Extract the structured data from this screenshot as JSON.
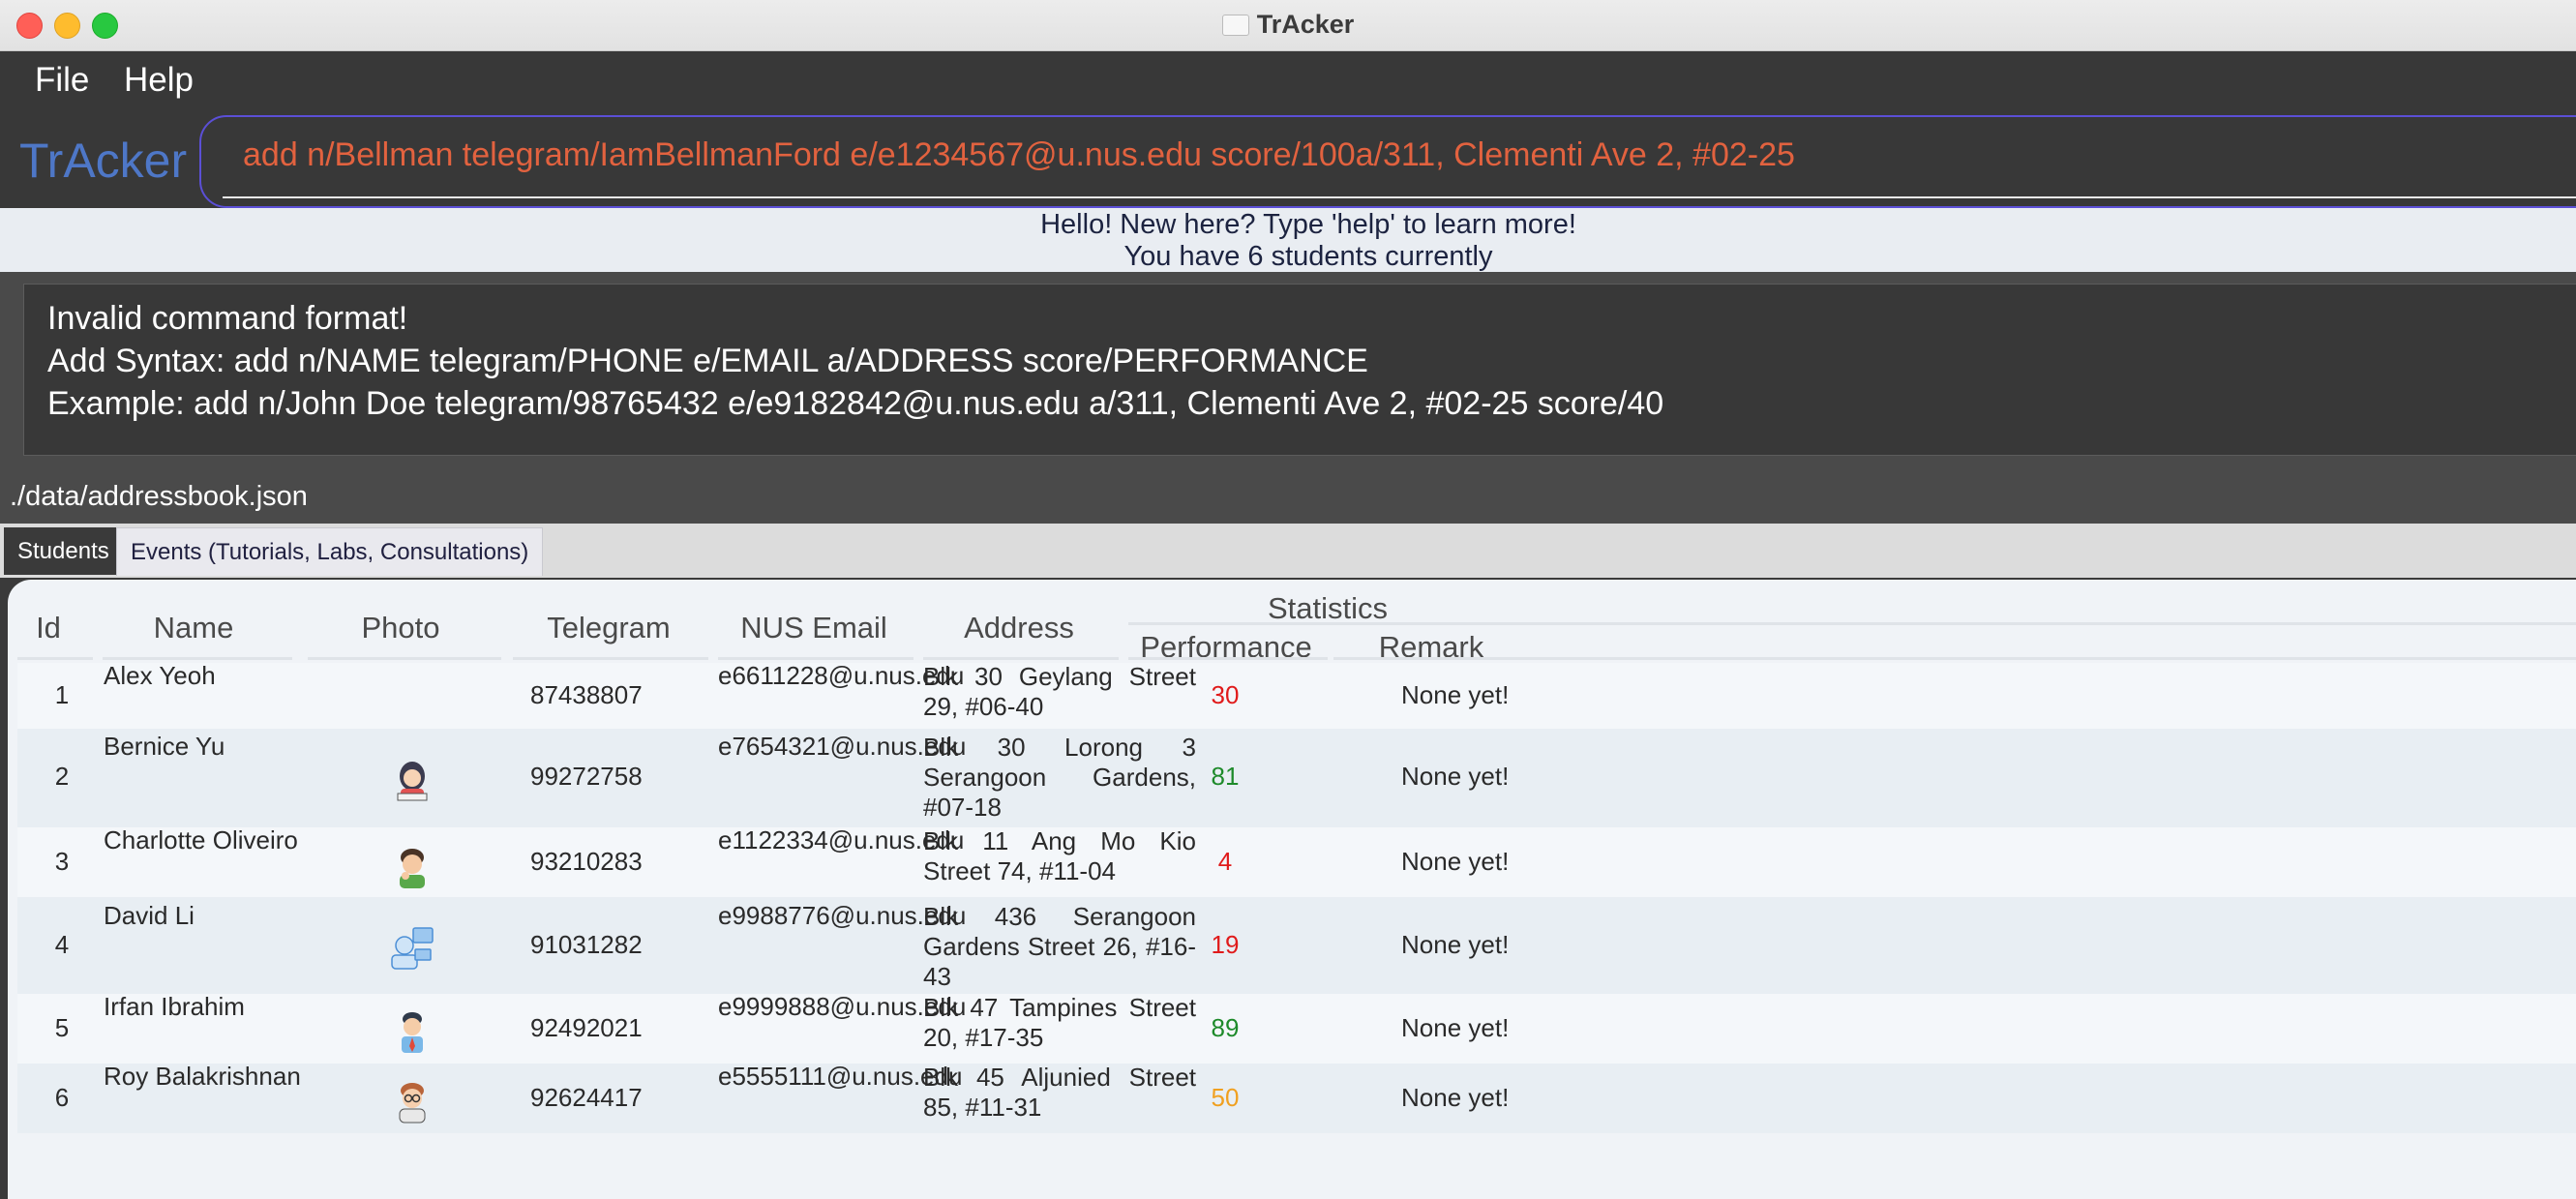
{
  "window": {
    "title": "TrAcker"
  },
  "menu": {
    "items": [
      "File",
      "Help"
    ]
  },
  "app": {
    "brand": "TrAcker"
  },
  "command": {
    "value": "add n/Bellman telegram/IamBellmanFord e/e1234567@u.nus.edu score/100a/311, Clementi Ave 2, #02-25"
  },
  "greeting": {
    "line1": "Hello! New here? Type 'help' to learn more!",
    "line2": "You have 6 students currently"
  },
  "result": {
    "lines": [
      "Invalid command format!",
      "Add Syntax: add n/NAME telegram/PHONE e/EMAIL a/ADDRESS score/PERFORMANCE",
      "Example: add n/John Doe telegram/98765432 e/e9182842@u.nus.edu a/311, Clementi Ave 2, #02-25 score/40"
    ]
  },
  "status": {
    "path": "./data/addressbook.json"
  },
  "tabs": [
    {
      "label": "Students",
      "selected": true
    },
    {
      "label": "Events (Tutorials, Labs, Consultations)",
      "selected": false
    }
  ],
  "table": {
    "headers": {
      "id": "Id",
      "name": "Name",
      "photo": "Photo",
      "telegram": "Telegram",
      "email": "NUS Email",
      "address": "Address",
      "statistics": "Statistics",
      "performance": "Performance",
      "remark": "Remark"
    },
    "colors": {
      "low": "#e01b1b",
      "high": "#1e8a2a",
      "mid": "#f0a020"
    },
    "rows": [
      {
        "id": "1",
        "name": "Alex Yeoh",
        "photo": "",
        "telegram": "87438807",
        "email": "e6611228@u.nus.edu",
        "address": "Blk 30 Geylang Street 29, #06-40",
        "performance": "30",
        "perf_level": "low",
        "remark": "None yet!"
      },
      {
        "id": "2",
        "name": "Bernice Yu",
        "photo": "girl-reading-avatar",
        "telegram": "99272758",
        "email": "e7654321@u.nus.edu",
        "address": "Blk 30 Lorong 3 Serangoon Gardens, #07-18",
        "performance": "81",
        "perf_level": "high",
        "remark": "None yet!"
      },
      {
        "id": "3",
        "name": "Charlotte Oliveiro",
        "photo": "boy-thinking-avatar",
        "telegram": "93210283",
        "email": "e1122334@u.nus.edu",
        "address": "Blk 11 Ang Mo Kio Street 74, #11-04",
        "performance": "4",
        "perf_level": "low",
        "remark": "None yet!"
      },
      {
        "id": "4",
        "name": "David Li",
        "photo": "person-computer-avatar",
        "telegram": "91031282",
        "email": "e9988776@u.nus.edu",
        "address": "Blk 436 Serangoon Gardens Street 26, #16-43",
        "performance": "19",
        "perf_level": "low",
        "remark": "None yet!"
      },
      {
        "id": "5",
        "name": "Irfan Ibrahim",
        "photo": "student-avatar",
        "telegram": "92492021",
        "email": "e9999888@u.nus.edu",
        "address": "Blk 47 Tampines Street 20, #17-35",
        "performance": "89",
        "perf_level": "high",
        "remark": "None yet!"
      },
      {
        "id": "6",
        "name": "Roy Balakrishnan",
        "photo": "man-glasses-avatar",
        "telegram": "92624417",
        "email": "e5555111@u.nus.edu",
        "address": "Blk 45 Aljunied Street 85, #11-31",
        "performance": "50",
        "perf_level": "mid",
        "remark": "None yet!"
      }
    ]
  }
}
